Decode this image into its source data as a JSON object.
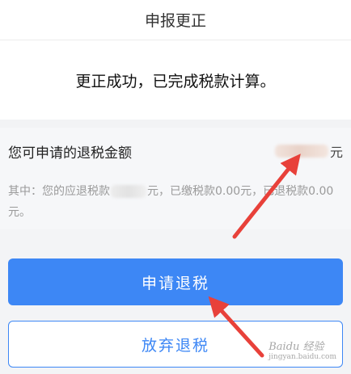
{
  "header": {
    "title": "申报更正"
  },
  "result": {
    "message": "更正成功，已完成税款计算。"
  },
  "refund": {
    "label": "您可申请的退税金额",
    "currency": "元"
  },
  "detail": {
    "part1": "其中：您的应退税款",
    "part2": "元，已缴税款0.00元，已退税款0.00元。"
  },
  "actions": {
    "apply_label": "申请退税",
    "abandon_label": "放弃退税"
  },
  "annotations": {
    "arrow_color": "#e8413a"
  },
  "watermark": {
    "text": "Baidu 经验",
    "sub": "jingyan.baidu.com"
  },
  "colors": {
    "accent": "#3d87f5",
    "card_bg": "#f6f7f9",
    "muted": "#9a9a9a"
  }
}
